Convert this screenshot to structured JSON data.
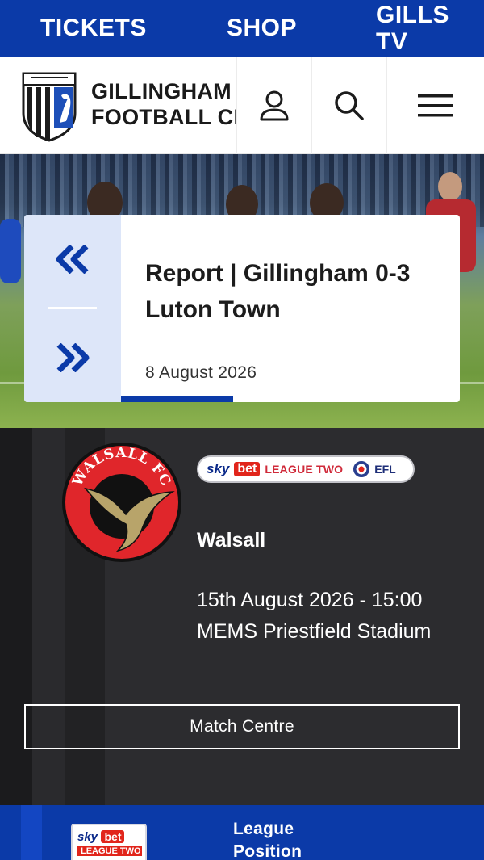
{
  "topnav": {
    "tickets": "TICKETS",
    "shop": "SHOP",
    "gills_tv": "GILLS TV"
  },
  "header": {
    "club_name_line1": "GILLINGHAM",
    "club_name_line2": "FOOTBALL CLUB",
    "crest_icon": "club-crest",
    "account_icon": "user-icon",
    "search_icon": "search-icon",
    "menu_icon": "hamburger-menu-icon"
  },
  "hero": {
    "title": "Report | Gillingham 0-3 Luton Town",
    "date": "8 August 2026",
    "prev_icon": "double-chevron-left-icon",
    "next_icon": "double-chevron-right-icon",
    "carousel_progress": 0.33
  },
  "fixture": {
    "competition_sky": "sky",
    "competition_bet": "bet",
    "competition_name": "LEAGUE TWO",
    "competition_org": "EFL",
    "opponent_badge_text": "WALSALL FC",
    "opponent": "Walsall",
    "datetime": "15th August 2026 - 15:00",
    "venue": "MEMS Priestfield Stadium",
    "match_centre": "Match Centre"
  },
  "league": {
    "badge_sky": "sky",
    "badge_bet": "bet",
    "badge_comp": "LEAGUE TWO",
    "label": "League Position"
  },
  "colors": {
    "brand_blue": "#0b3aa8",
    "accent_red": "#e1251b",
    "dark_bg": "#2c2c2f",
    "panel_light_blue": "#dde6f9"
  }
}
